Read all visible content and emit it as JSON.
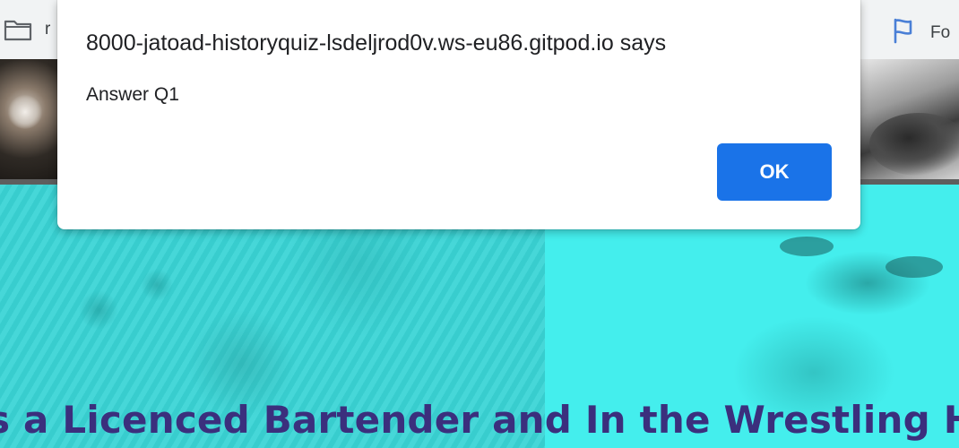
{
  "bookmarks": {
    "left_label": "r",
    "right_label": "Fo"
  },
  "alert": {
    "title": "8000-jatoad-historyquiz-lsdeljrod0v.ws-eu86.gitpod.io says",
    "message": "Answer Q1",
    "ok_label": "OK"
  },
  "page": {
    "banner_text": "s a Licenced Bartender and In the Wrestling Ha"
  },
  "colors": {
    "ok_button": "#1a73e8",
    "banner_text": "#3b2f7d",
    "content_tint": "#31e6e8"
  }
}
